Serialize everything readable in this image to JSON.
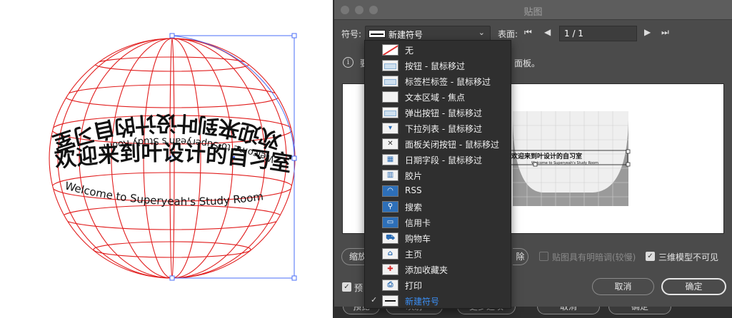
{
  "dialog": {
    "title": "贴图",
    "symbol_label": "符号:",
    "symbol_value": "新建符号",
    "surface_label": "表面:",
    "page_value": "1 / 1",
    "info_prefix": "要",
    "info_suffix": "面板。",
    "buttons": {
      "scale_partial": "缩放",
      "clear_partial": "除",
      "cancel": "取消",
      "ok": "确定"
    },
    "options": {
      "shading_label": "贴图具有明暗调(较慢)",
      "shading_checked": false,
      "invisible_label": "三维模型不可见",
      "invisible_checked": true,
      "preview_partial": "预",
      "preview_checked": true
    }
  },
  "background_buttons": [
    "预览",
    "映射",
    "更多选项",
    "取消",
    "确定"
  ],
  "menu": {
    "items": [
      {
        "label": "无",
        "icon": "none-icon",
        "checked": false
      },
      {
        "label": "按钮 - 鼠标移过",
        "icon": "button-rollover-icon",
        "checked": false
      },
      {
        "label": "标签栏标签 - 鼠标移过",
        "icon": "tab-rollover-icon",
        "checked": false
      },
      {
        "label": "文本区域 - 焦点",
        "icon": "text-area-focus-icon",
        "checked": false
      },
      {
        "label": "弹出按钮 - 鼠标移过",
        "icon": "popup-button-icon",
        "checked": false
      },
      {
        "label": "下拉列表 - 鼠标移过",
        "icon": "dropdown-list-icon",
        "checked": false
      },
      {
        "label": "面板关闭按钮 - 鼠标移过",
        "icon": "panel-close-icon",
        "checked": false
      },
      {
        "label": "日期字段 - 鼠标移过",
        "icon": "date-field-icon",
        "checked": false
      },
      {
        "label": "胶片",
        "icon": "film-icon",
        "checked": false
      },
      {
        "label": "RSS",
        "icon": "rss-icon",
        "checked": false
      },
      {
        "label": "搜索",
        "icon": "search-icon",
        "checked": false
      },
      {
        "label": "信用卡",
        "icon": "credit-card-icon",
        "checked": false
      },
      {
        "label": "购物车",
        "icon": "shopping-cart-icon",
        "checked": false
      },
      {
        "label": "主页",
        "icon": "home-icon",
        "checked": false
      },
      {
        "label": "添加收藏夹",
        "icon": "add-favorite-icon",
        "checked": false
      },
      {
        "label": "打印",
        "icon": "print-icon",
        "checked": false
      },
      {
        "label": "新建符号",
        "icon": "new-symbol-icon",
        "checked": true
      }
    ]
  },
  "artwork": {
    "line1": "欢迎来到叶设计的自习室",
    "line2": "Welcome to Superyeah's Study Room"
  },
  "colors": {
    "wireframe": "#e11d1d",
    "selection": "#4a6cf7",
    "dialog_bg": "#4b4b4b",
    "menu_bg": "#2f2f2f",
    "checked_item": "#3b8ff5"
  }
}
